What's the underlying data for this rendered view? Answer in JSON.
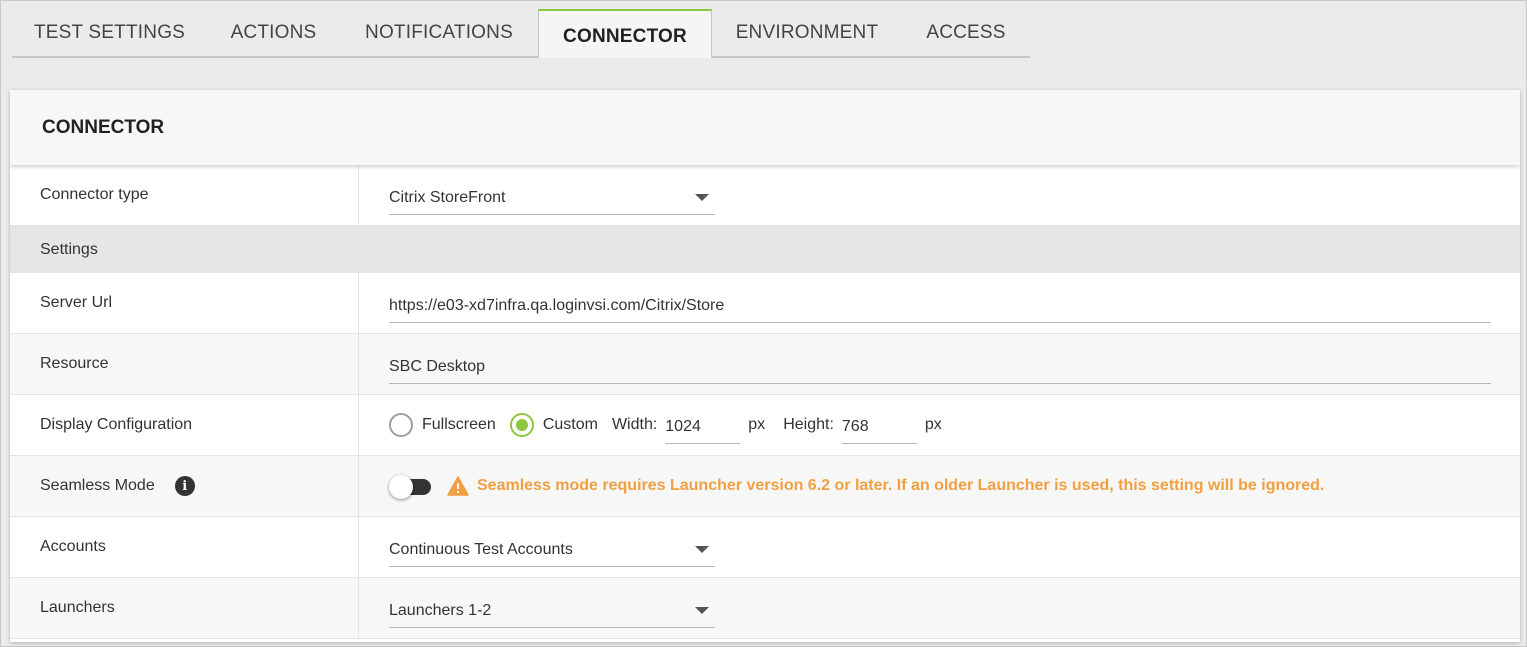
{
  "tabs": [
    {
      "label": "TEST SETTINGS"
    },
    {
      "label": "ACTIONS"
    },
    {
      "label": "NOTIFICATIONS"
    },
    {
      "label": "CONNECTOR"
    },
    {
      "label": "ENVIRONMENT"
    },
    {
      "label": "ACCESS"
    }
  ],
  "active_tab": "CONNECTOR",
  "panel": {
    "title": "CONNECTOR",
    "connector_type": {
      "label": "Connector type",
      "value": "Citrix StoreFront"
    },
    "settings_section": "Settings",
    "server_url": {
      "label": "Server Url",
      "value": "https://e03-xd7infra.qa.loginvsi.com/Citrix/Store"
    },
    "resource": {
      "label": "Resource",
      "value": "SBC Desktop"
    },
    "display_configuration": {
      "label": "Display Configuration",
      "option_fullscreen": "Fullscreen",
      "option_custom": "Custom",
      "selected": "Custom",
      "width_label": "Width:",
      "width_value": "1024",
      "height_label": "Height:",
      "height_value": "768",
      "unit": "px"
    },
    "seamless_mode": {
      "label": "Seamless Mode",
      "enabled": false,
      "warning": "Seamless mode requires Launcher version 6.2 or later. If an older Launcher is used, this setting will be ignored."
    },
    "accounts": {
      "label": "Accounts",
      "value": "Continuous Test Accounts"
    },
    "launchers": {
      "label": "Launchers",
      "value": "Launchers 1-2"
    }
  },
  "colors": {
    "accent": "#8dc63f",
    "warning": "#f0a043"
  }
}
